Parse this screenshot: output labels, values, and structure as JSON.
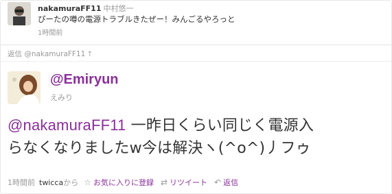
{
  "parent_tweet": {
    "screen_name": "nakamuraFF11",
    "real_name": "中村悠一",
    "text": "ぴーたの噂の電源トラブルきたぜー！みんごるやろっと",
    "time": "1時間前"
  },
  "reply_to": {
    "label": "返信 @nakamuraFF11",
    "arrow": "↑"
  },
  "main_tweet": {
    "screen_name": "@Emiryun",
    "real_name": "えみり",
    "mention": "@nakamuraFF11",
    "text_line1_rest": " 一昨日くらい同じく電源入",
    "text_line2": "らなくなりましたw今は解決ヽ(^o^)丿フゥ",
    "time": "1時間前",
    "source_app": "twicca",
    "source_suffix": "から"
  },
  "actions": [
    {
      "icon": "star-icon",
      "glyph": "☆",
      "label": "お気に入りに登録"
    },
    {
      "icon": "retweet-icon",
      "glyph": "⇄",
      "label": "リツイート"
    },
    {
      "icon": "reply-icon",
      "glyph": "↶",
      "label": "返信"
    }
  ],
  "colors": {
    "accent": "#8a2f9a",
    "muted": "#999999",
    "text": "#333333"
  }
}
